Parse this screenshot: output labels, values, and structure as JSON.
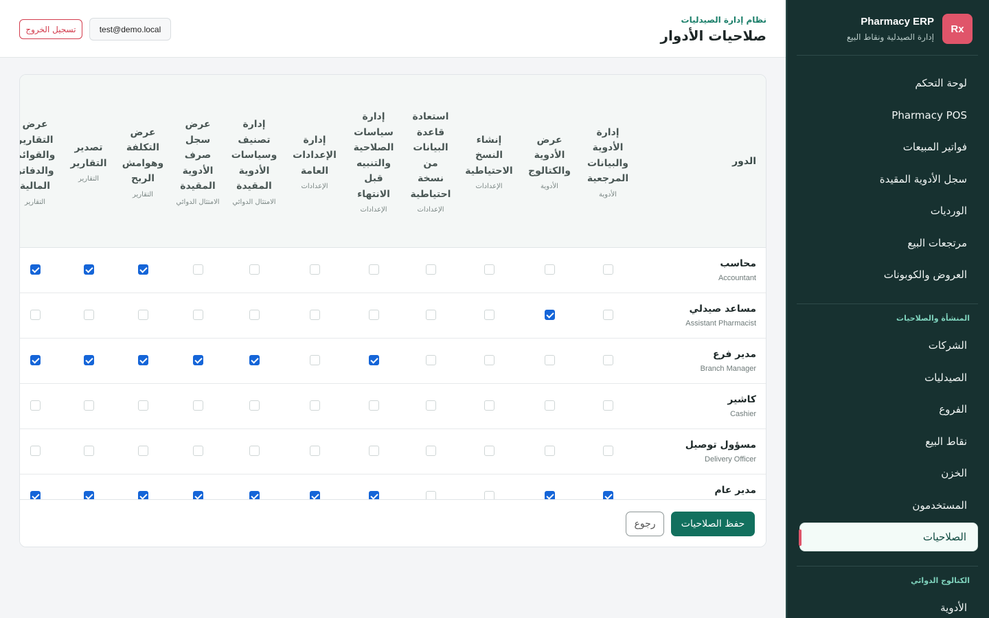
{
  "brand": {
    "logo": "Rx",
    "title": "Pharmacy ERP",
    "subtitle": "إدارة الصيدلية ونقاط البيع"
  },
  "nav": {
    "items_top": [
      "لوحة التحكم",
      "Pharmacy POS",
      "فواتير المبيعات",
      "سجل الأدوية المقيدة",
      "الورديات",
      "مرتجعات البيع",
      "العروض والكوبونات"
    ],
    "section_org": "المنشأة والصلاحيات",
    "items_org": [
      "الشركات",
      "الصيدليات",
      "الفروع",
      "نقاط البيع",
      "الخزن",
      "المستخدمون",
      "الصلاحيات"
    ],
    "active_item": "الصلاحيات",
    "section_catalog": "الكتالوج الدوائي",
    "items_catalog": [
      "الأدوية"
    ]
  },
  "header": {
    "kicker": "نظام إدارة الصيدليات",
    "title": "صلاحيات الأدوار",
    "user_email": "test@demo.local",
    "logout_label": "تسجيل الخروج"
  },
  "table": {
    "role_header": "الدور",
    "columns": [
      {
        "label": "إدارة\nالأدوية\nوالبيانات\nالمرجعية",
        "group": "الأدوية"
      },
      {
        "label": "عرض\nالأدوية\nوالكتالوج",
        "group": "الأدوية"
      },
      {
        "label": "إنشاء\nالنسخ\nالاحتياطية",
        "group": "الإعدادات"
      },
      {
        "label": "استعادة\nقاعدة\nالبيانات\nمن\nنسخة\nاحتياطية",
        "group": "الإعدادات"
      },
      {
        "label": "إدارة\nسياسات\nالصلاحية\nوالتنبيه\nقبل\nالانتهاء",
        "group": "الإعدادات"
      },
      {
        "label": "إدارة\nالإعدادات\nالعامة",
        "group": "الإعدادات"
      },
      {
        "label": "إدارة\nتصنيف\nوسياسات\nالأدوية\nالمقيدة",
        "group": "الامتثال\nالدوائي"
      },
      {
        "label": "عرض\nسجل\nصرف\nالأدوية\nالمقيدة",
        "group": "الامتثال\nالدوائي"
      },
      {
        "label": "عرض\nالتكلفة\nوهوامش\nالربح",
        "group": "التقارير"
      },
      {
        "label": "تصدير\nالتقارير",
        "group": "التقارير"
      },
      {
        "label": "عرض\nالتقارير\nوالقوائم\nوالدفاتر\nالمالية",
        "group": "التقارير"
      }
    ],
    "roles": [
      {
        "name": "محاسب",
        "name_en": "Accountant",
        "perms": [
          false,
          false,
          false,
          false,
          false,
          false,
          false,
          false,
          true,
          true,
          true
        ]
      },
      {
        "name": "مساعد صيدلي",
        "name_en": "Assistant Pharmacist",
        "perms": [
          false,
          true,
          false,
          false,
          false,
          false,
          false,
          false,
          false,
          false,
          false
        ]
      },
      {
        "name": "مدير فرع",
        "name_en": "Branch Manager",
        "perms": [
          false,
          false,
          false,
          false,
          true,
          false,
          true,
          true,
          true,
          true,
          true
        ]
      },
      {
        "name": "كاشير",
        "name_en": "Cashier",
        "perms": [
          false,
          false,
          false,
          false,
          false,
          false,
          false,
          false,
          false,
          false,
          false
        ]
      },
      {
        "name": "مسؤول توصيل",
        "name_en": "Delivery Officer",
        "perms": [
          false,
          false,
          false,
          false,
          false,
          false,
          false,
          false,
          false,
          false,
          false
        ]
      },
      {
        "name": "مدير عام",
        "name_en": "",
        "perms": [
          true,
          true,
          false,
          false,
          true,
          true,
          true,
          true,
          true,
          true,
          true
        ]
      }
    ]
  },
  "footer": {
    "save_label": "حفظ الصلاحيات",
    "back_label": "رجوع"
  },
  "colors": {
    "sidebar_bg": "#173130",
    "primary": "#12705e",
    "accent_red": "#e0556a",
    "checkbox_on": "#1565d8"
  }
}
